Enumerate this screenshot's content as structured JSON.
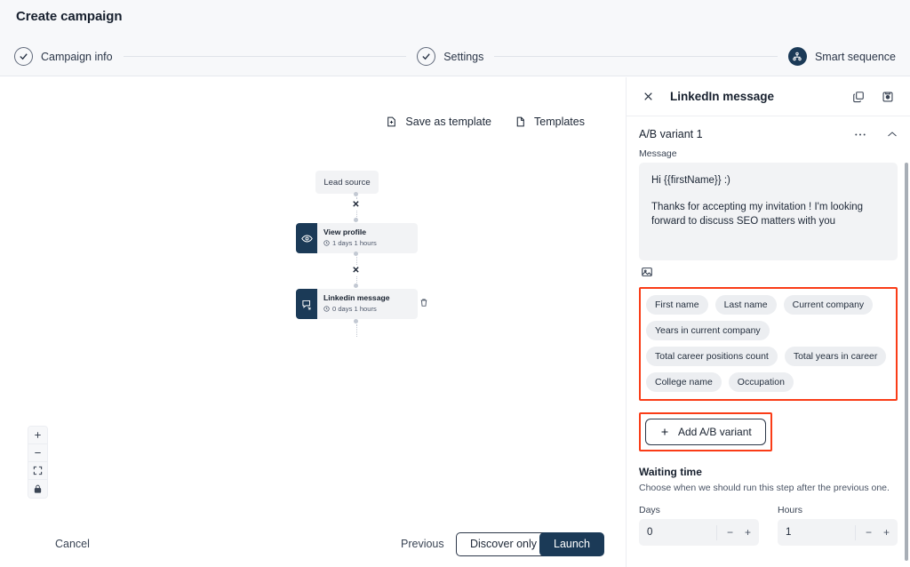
{
  "header": {
    "title": "Create campaign",
    "steps": [
      {
        "label": "Campaign info",
        "state": "done",
        "icon": "check-circle-icon"
      },
      {
        "label": "Settings",
        "state": "done",
        "icon": "check-circle-icon"
      },
      {
        "label": "Smart sequence",
        "state": "active",
        "icon": "sequence-icon"
      }
    ]
  },
  "canvas": {
    "tools": [
      {
        "label": "Save as template",
        "icon": "save-template-icon"
      },
      {
        "label": "Templates",
        "icon": "document-icon"
      }
    ],
    "nodes": [
      {
        "title": "Lead source",
        "type": "lead-source"
      },
      {
        "title": "View profile",
        "delay": "1 days 1 hours",
        "icon": "eye-icon"
      },
      {
        "title": "Linkedin message",
        "delay": "0 days 1 hours",
        "icon": "message-icon"
      }
    ],
    "zoom_controls": [
      {
        "name": "zoom-in",
        "glyph": "+"
      },
      {
        "name": "zoom-out",
        "glyph": "−"
      },
      {
        "name": "fit-screen",
        "glyph": "fit"
      },
      {
        "name": "lock",
        "glyph": "lock"
      }
    ]
  },
  "footer": {
    "cancel": "Cancel",
    "previous": "Previous",
    "discover_only": "Discover only",
    "launch": "Launch"
  },
  "panel": {
    "title": "LinkedIn message",
    "close_icon": "close-icon",
    "head_icons": [
      {
        "name": "duplicate-icon"
      },
      {
        "name": "save-icon"
      }
    ],
    "variant": {
      "title": "A/B variant 1",
      "more_icon": "more-horizontal-icon",
      "collapse_icon": "chevron-up-icon"
    },
    "message": {
      "label": "Message",
      "line1": "Hi  {{firstName}} :)",
      "line2": "Thanks for accepting my invitation ! I'm looking forward to discuss SEO matters with you",
      "attach_icon": "image-icon"
    },
    "variables": [
      "First name",
      "Last name",
      "Current company",
      "Years in current company",
      "Total career positions count",
      "Total years in career",
      "College name",
      "Occupation"
    ],
    "add_variant_label": "Add A/B variant",
    "waiting": {
      "title": "Waiting time",
      "subtitle": "Choose when we should run this step after the previous one.",
      "days_label": "Days",
      "days_value": "0",
      "hours_label": "Hours",
      "hours_value": "1",
      "minus": "−",
      "plus": "+"
    },
    "highlight_color": "#fa3c17",
    "accent_color": "#1b3a57"
  }
}
